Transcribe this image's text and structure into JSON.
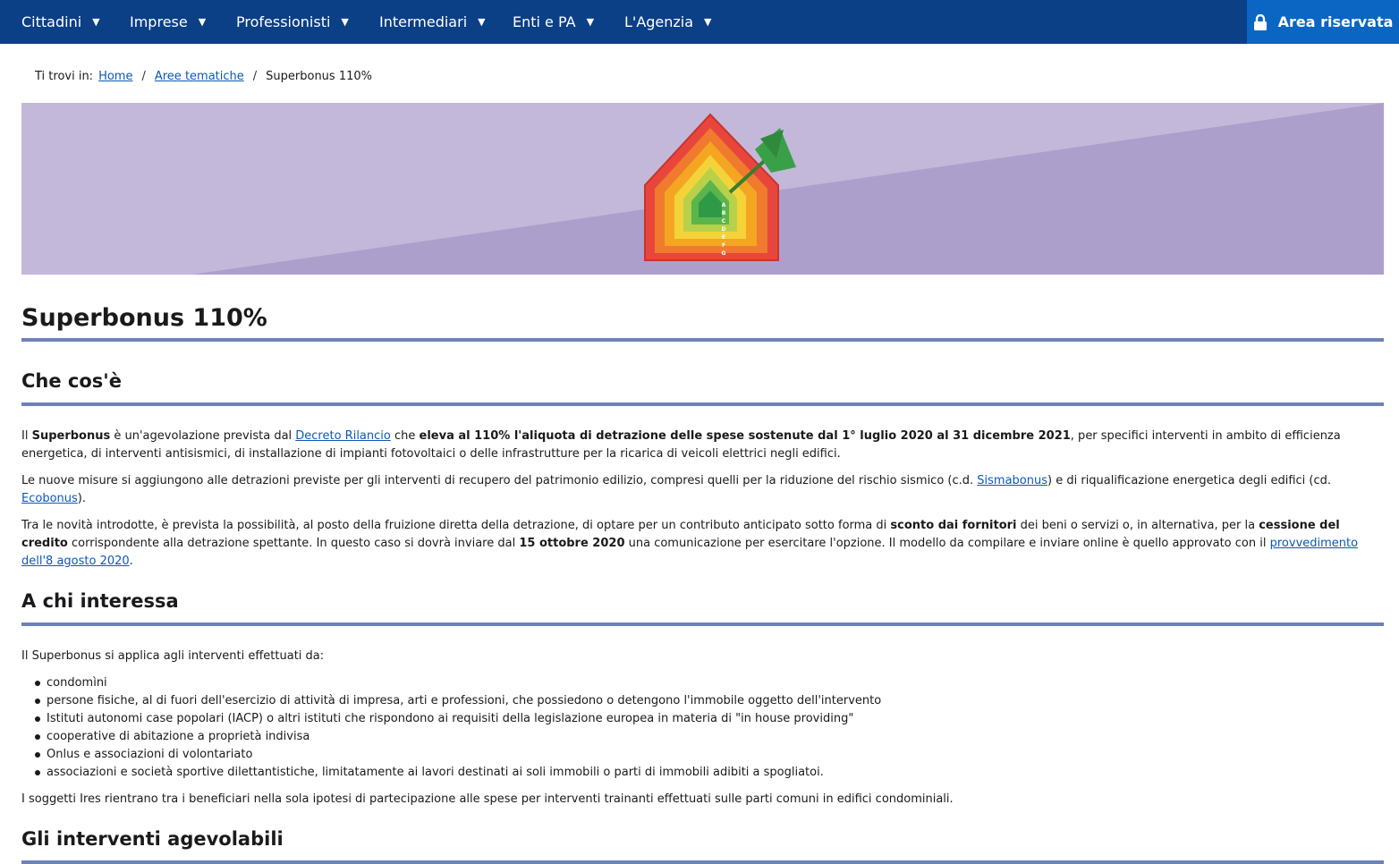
{
  "nav": {
    "items": [
      {
        "label": "Cittadini"
      },
      {
        "label": "Imprese"
      },
      {
        "label": "Professionisti"
      },
      {
        "label": "Intermediari"
      },
      {
        "label": "Enti e PA"
      },
      {
        "label": "L'Agenzia"
      }
    ],
    "area_label": "Area riservata"
  },
  "breadcrumb": {
    "label": "Ti trovi in:",
    "home": "Home",
    "aree": "Aree tematiche",
    "current": "Superbonus 110%"
  },
  "hero": {
    "energy_classes": [
      "A",
      "B",
      "C",
      "D",
      "E",
      "F",
      "G"
    ]
  },
  "page": {
    "title": "Superbonus 110%"
  },
  "section1": {
    "title": "Che cos'è",
    "p1": {
      "t1": "Il ",
      "b1": "Superbonus",
      "t2": " è un'agevolazione prevista dal ",
      "link1": "Decreto Rilancio",
      "t3": " che ",
      "b2": "eleva al 110% l'aliquota di detrazione delle spese sostenute dal 1° luglio 2020 al 31 dicembre 2021",
      "t4": ", per specifici interventi in ambito di efficienza energetica, di interventi antisismici, di installazione di impianti fotovoltaici o delle infrastrutture per la ricarica di veicoli elettrici negli edifici."
    },
    "p2": {
      "t1": "Le nuove misure si aggiungono alle detrazioni previste per gli interventi di recupero del patrimonio edilizio, compresi quelli per la riduzione del rischio sismico (c.d. ",
      "link1": "Sismabonus",
      "t2": ") e di riqualificazione energetica degli edifici (cd. ",
      "link2": "Ecobonus",
      "t3": ")."
    },
    "p3": {
      "t1": "Tra le novità introdotte, è prevista la possibilità, al posto della fruizione diretta della detrazione, di optare per un contributo anticipato sotto forma di ",
      "b1": "sconto dai fornitori",
      "t2": " dei beni o servizi o, in alternativa, per la ",
      "b2": "cessione del credito",
      "t3": " corrispondente alla detrazione spettante. In questo caso si dovrà inviare dal ",
      "b3": "15 ottobre 2020",
      "t4": " una comunicazione per esercitare l'opzione. Il modello da compilare e inviare online è quello approvato con il ",
      "link1": "provvedimento dell'8 agosto 2020",
      "t5": "."
    }
  },
  "section2": {
    "title": "A chi interessa",
    "intro": "Il Superbonus si applica agli interventi effettuati da:",
    "items": [
      "condomìni",
      "persone fisiche, al di fuori dell'esercizio di attività di impresa, arti e professioni, che possiedono o detengono l'immobile oggetto dell'intervento",
      "Istituti autonomi case popolari (IACP) o altri istituti che rispondono ai requisiti della legislazione europea in materia di \"in house providing\"",
      "cooperative di abitazione a proprietà indivisa",
      "Onlus e associazioni di volontariato",
      "associazioni e società sportive dilettantistiche, limitatamente ai lavori destinati ai soli immobili o parti di immobili adibiti a spogliatoi."
    ],
    "outro": "I soggetti Ires rientrano tra i beneficiari nella sola ipotesi di partecipazione alle spese per interventi trainanti effettuati sulle parti comuni in edifici condominiali."
  },
  "section3": {
    "title": "Gli interventi agevolabili"
  }
}
